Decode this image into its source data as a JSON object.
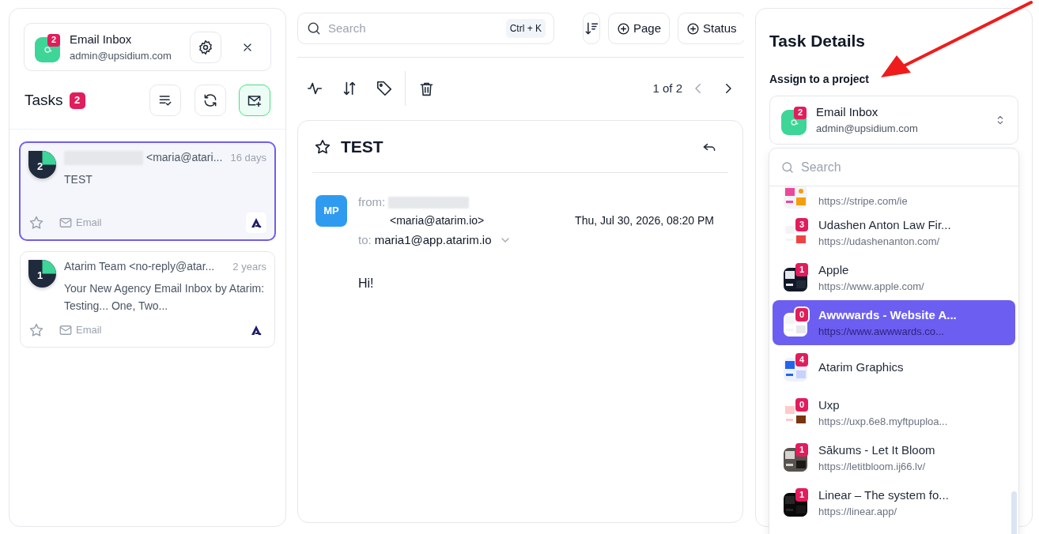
{
  "inbox_header": {
    "title": "Email Inbox",
    "email": "admin@upsidium.com",
    "count": "2"
  },
  "tasks": {
    "title": "Tasks",
    "count": "2"
  },
  "task_cards": [
    {
      "count": "2",
      "redacted": true,
      "sender": "<maria@atari...",
      "time": "16 days",
      "subject": "TEST",
      "tag": "Email",
      "selected": true,
      "starred": false
    },
    {
      "count": "1",
      "redacted": false,
      "sender": "Atarim Team <no-reply@atar...",
      "time": "2 years",
      "subject": "Your New Agency Email Inbox by Atarim: Testing... One, Two...",
      "tag": "Email",
      "selected": false,
      "starred": false
    }
  ],
  "toolbar": {
    "search_placeholder": "Search",
    "shortcut": "Ctrl + K",
    "buttons": [
      "Page",
      "Status"
    ]
  },
  "pager": {
    "text": "1 of 2"
  },
  "email": {
    "subject": "TEST",
    "starred": false,
    "avatar": "MP",
    "from_label": "from:",
    "from_redacted": true,
    "from_address": "<maria@atarim.io>",
    "date": "Thu, Jul 30, 2026, 08:20 PM",
    "to_label": "to:",
    "to": "maria1@app.atarim.io",
    "body": "Hi!"
  },
  "details": {
    "title": "Task Details",
    "assign_label": "Assign to a project",
    "project": {
      "title": "Email Inbox",
      "email": "admin@upsidium.com",
      "count": "2"
    },
    "search_placeholder": "Search",
    "projects": [
      {
        "url": "https://stripe.com/ie",
        "selected": false
      },
      {
        "title": "Udashen Anton Law Fir...",
        "url": "https://udashenanton.com/",
        "count": "3",
        "selected": false
      },
      {
        "title": "Apple",
        "url": "https://www.apple.com/",
        "count": "1",
        "selected": false
      },
      {
        "title": "Awwwards - Website A...",
        "url": "https://www.awwwards.co...",
        "count": "0",
        "selected": true
      },
      {
        "title": "Atarim Graphics",
        "count": "4",
        "selected": false
      },
      {
        "title": "Uxp",
        "url": "https://uxp.6e8.myftpuploa...",
        "count": "0",
        "selected": false
      },
      {
        "title": "Sākums - Let It Bloom",
        "url": "https://letitbloom.ij66.lv/",
        "count": "1",
        "selected": false
      },
      {
        "title": "Linear – The system fo...",
        "url": "https://linear.app/",
        "count": "1",
        "selected": false
      }
    ]
  }
}
